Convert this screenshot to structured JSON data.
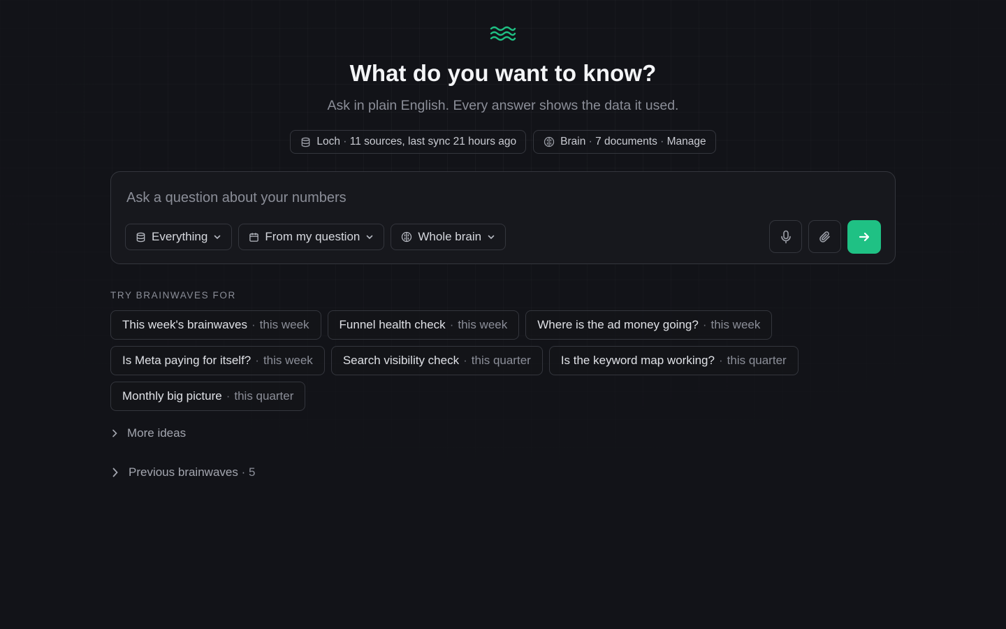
{
  "logo": {
    "icon": "waves-icon",
    "color": "#1fc184"
  },
  "header": {
    "title": "What do you want to know?",
    "subtitle": "Ask in plain English. Every answer shows the data it used."
  },
  "status": {
    "source": {
      "name": "Loch",
      "detail": "11 sources, last sync 21 hours ago",
      "icon": "database-icon"
    },
    "brain": {
      "name": "Brain",
      "detail": "7 documents",
      "action": "Manage",
      "icon": "brain-icon"
    }
  },
  "composer": {
    "placeholder": "Ask a question about your numbers",
    "value": "",
    "selectors": [
      {
        "label": "Everything",
        "icon": "database-icon"
      },
      {
        "label": "From my question",
        "icon": "calendar-icon"
      },
      {
        "label": "Whole brain",
        "icon": "brain-icon"
      }
    ],
    "actions": {
      "mic": "microphone-icon",
      "attach": "paperclip-icon",
      "send": "arrow-right-icon"
    }
  },
  "suggestions": {
    "label": "TRY BRAINWAVES FOR",
    "rows": [
      [
        {
          "question": "This week's brainwaves",
          "period": "this week"
        },
        {
          "question": "Funnel health check",
          "period": "this week"
        },
        {
          "question": "Where is the ad money going?",
          "period": "this week"
        }
      ],
      [
        {
          "question": "Is Meta paying for itself?",
          "period": "this week"
        },
        {
          "question": "Search visibility check",
          "period": "this quarter"
        },
        {
          "question": "Is the keyword map working?",
          "period": "this quarter"
        }
      ],
      [
        {
          "question": "Monthly big picture",
          "period": "this quarter"
        }
      ]
    ]
  },
  "more_ideas": {
    "label": "More ideas"
  },
  "previous": {
    "label": "Previous brainwaves",
    "count": "5"
  },
  "colors": {
    "accent": "#1fc184",
    "background": "#121318",
    "border": "#34363d"
  }
}
